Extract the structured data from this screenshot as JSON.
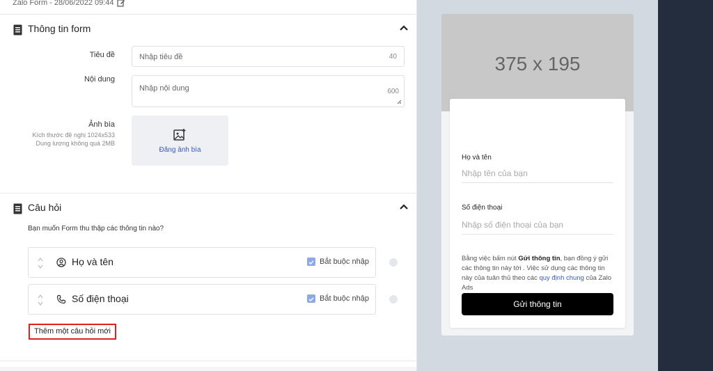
{
  "topbar": {
    "title": "Zalo Form - 28/06/2022 09:44"
  },
  "form_info": {
    "title": "Thông tin form",
    "title_label": "Tiêu đề",
    "title_placeholder": "Nhập tiêu đề",
    "title_limit": "40",
    "content_label": "Nội dung",
    "content_placeholder": "Nhập nội dung",
    "content_limit": "600",
    "cover_label": "Ảnh bìa",
    "cover_hint1": "Kích thước đề nghị 1024x533",
    "cover_hint2": "Dung lượng không quá 2MB",
    "upload_label": "Đăng ảnh bìa"
  },
  "questions": {
    "title": "Câu hỏi",
    "prompt": "Bạn muốn Form thu thập các thông tin nào?",
    "items": [
      {
        "label": "Họ và tên",
        "required_label": "Bắt buộc nhập",
        "icon": "user-circle-icon"
      },
      {
        "label": "Số điện thoại",
        "required_label": "Bắt buộc nhập",
        "icon": "phone-icon"
      }
    ],
    "add_label": "Thêm một câu hỏi mới"
  },
  "preview": {
    "cover_size": "375 x 195",
    "name_label": "Họ và tên",
    "name_placeholder": "Nhập tên của bạn",
    "phone_label": "Số điện thoại",
    "phone_placeholder": "Nhập số điện thoại của bạn",
    "consent_1": "Bằng việc bấm nút ",
    "consent_bold": "Gửi thông tin",
    "consent_2": ", bạn đồng ý gửi các thông tin này tới . Việc sử dụng các thông tin này của tuân thủ theo các ",
    "consent_link": "quy định chung",
    "consent_3": " của Zalo Ads",
    "submit_label": "Gửi thông tin"
  },
  "colors": {
    "accent": "#3a5ab5",
    "checkbox": "#8ea8e8",
    "highlight": "#e0201c",
    "submit": "#000000"
  }
}
